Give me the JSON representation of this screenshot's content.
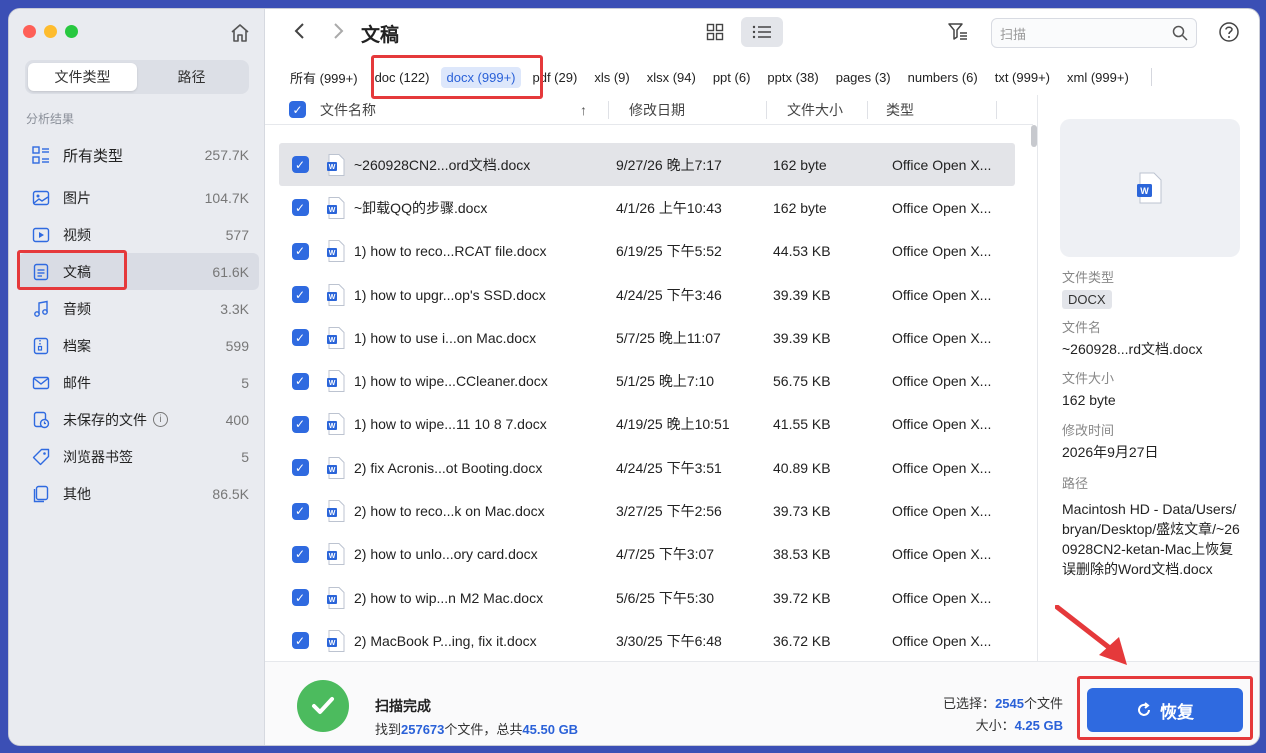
{
  "sidebar": {
    "seg_tabs": [
      "文件类型",
      "路径"
    ],
    "section_label": "分析结果",
    "all": {
      "label": "所有类型",
      "count": "257.7K"
    },
    "items": [
      {
        "label": "图片",
        "count": "104.7K",
        "icon": "image-icon"
      },
      {
        "label": "视频",
        "count": "577",
        "icon": "video-icon"
      },
      {
        "label": "文稿",
        "count": "61.6K",
        "icon": "document-icon"
      },
      {
        "label": "音频",
        "count": "3.3K",
        "icon": "music-icon"
      },
      {
        "label": "档案",
        "count": "599",
        "icon": "archive-icon"
      },
      {
        "label": "邮件",
        "count": "5",
        "icon": "mail-icon"
      },
      {
        "label": "未保存的文件",
        "count": "400",
        "icon": "unsaved-icon"
      },
      {
        "label": "浏览器书签",
        "count": "5",
        "icon": "bookmark-icon"
      },
      {
        "label": "其他",
        "count": "86.5K",
        "icon": "other-icon"
      }
    ]
  },
  "toolbar": {
    "title": "文稿",
    "search_placeholder": "扫描"
  },
  "filter_tabs": [
    "所有 (999+)",
    "doc (122)",
    "docx (999+)",
    "pdf (29)",
    "xls (9)",
    "xlsx (94)",
    "ppt (6)",
    "pptx (38)",
    "pages (3)",
    "numbers (6)",
    "txt (999+)",
    "xml (999+)"
  ],
  "table": {
    "headers": {
      "name": "文件名称",
      "date": "修改日期",
      "size": "文件大小",
      "type": "类型"
    },
    "rows": [
      {
        "name": "~260928CN2...ord文档.docx",
        "date": "9/27/26 晚上7:17",
        "size": "162 byte",
        "type": "Office Open X..."
      },
      {
        "name": "~卸载QQ的步骤.docx",
        "date": "4/1/26 上午10:43",
        "size": "162 byte",
        "type": "Office Open X..."
      },
      {
        "name": "1) how to reco...RCAT file.docx",
        "date": "6/19/25 下午5:52",
        "size": "44.53 KB",
        "type": "Office Open X..."
      },
      {
        "name": "1) how to upgr...op's SSD.docx",
        "date": "4/24/25 下午3:46",
        "size": "39.39 KB",
        "type": "Office Open X..."
      },
      {
        "name": "1) how to use i...on Mac.docx",
        "date": "5/7/25 晚上11:07",
        "size": "39.39 KB",
        "type": "Office Open X..."
      },
      {
        "name": "1) how to wipe...CCleaner.docx",
        "date": "5/1/25 晚上7:10",
        "size": "56.75 KB",
        "type": "Office Open X..."
      },
      {
        "name": "1) how to wipe...11 10 8 7.docx",
        "date": "4/19/25 晚上10:51",
        "size": "41.55 KB",
        "type": "Office Open X..."
      },
      {
        "name": "2) fix Acronis...ot Booting.docx",
        "date": "4/24/25 下午3:51",
        "size": "40.89 KB",
        "type": "Office Open X..."
      },
      {
        "name": "2) how to reco...k on Mac.docx",
        "date": "3/27/25 下午2:56",
        "size": "39.73 KB",
        "type": "Office Open X..."
      },
      {
        "name": "2) how to unlo...ory card.docx",
        "date": "4/7/25 下午3:07",
        "size": "38.53 KB",
        "type": "Office Open X..."
      },
      {
        "name": "2) how to wip...n M2 Mac.docx",
        "date": "5/6/25 下午5:30",
        "size": "39.72 KB",
        "type": "Office Open X..."
      },
      {
        "name": "2) MacBook P...ing, fix it.docx",
        "date": "3/30/25 下午6:48",
        "size": "36.72 KB",
        "type": "Office Open X..."
      }
    ]
  },
  "preview": {
    "type_label": "文件类型",
    "type_value": "DOCX",
    "name_label": "文件名",
    "name_value": "~260928...rd文档.docx",
    "size_label": "文件大小",
    "size_value": "162 byte",
    "time_label": "修改时间",
    "time_value": "2026年9月27日",
    "path_label": "路径",
    "path_value": "Macintosh HD - Data/Users/bryan/Desktop/盛炫文章/~260928CN2-ketan-Mac上恢复误删除的Word文档.docx"
  },
  "footer": {
    "done_title": "扫描完成",
    "found_prefix": "找到",
    "found_count": "257673",
    "found_mid": "个文件，总共",
    "found_size": "45.50 GB",
    "selected_label": "已选择：",
    "selected_count": "2545",
    "selected_suffix": "个文件",
    "size_label": "大小：",
    "size_value": "4.25 GB",
    "recover_label": "恢复"
  },
  "colors": {
    "accent": "#2f6ae0",
    "highlight": "#e5393b",
    "success": "#4cbb5e"
  }
}
